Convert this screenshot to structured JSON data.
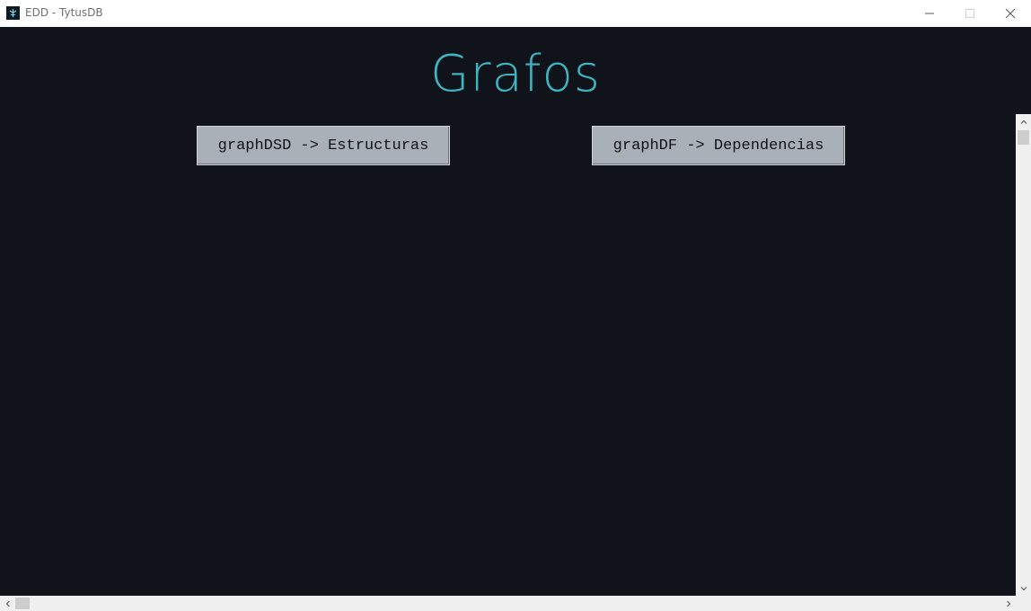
{
  "window": {
    "title": "EDD - TytusDB",
    "icon": "app-logo-icon",
    "controls": [
      "minimize-icon",
      "maximize-icon",
      "close-icon"
    ]
  },
  "main": {
    "heading": "Grafos",
    "buttons": [
      {
        "label": "graphDSD -> Estructuras"
      },
      {
        "label": "graphDF -> Dependencias"
      }
    ]
  },
  "colors": {
    "background": "#101319",
    "heading": "#3fb5c1",
    "button": "#a9b0b8"
  }
}
